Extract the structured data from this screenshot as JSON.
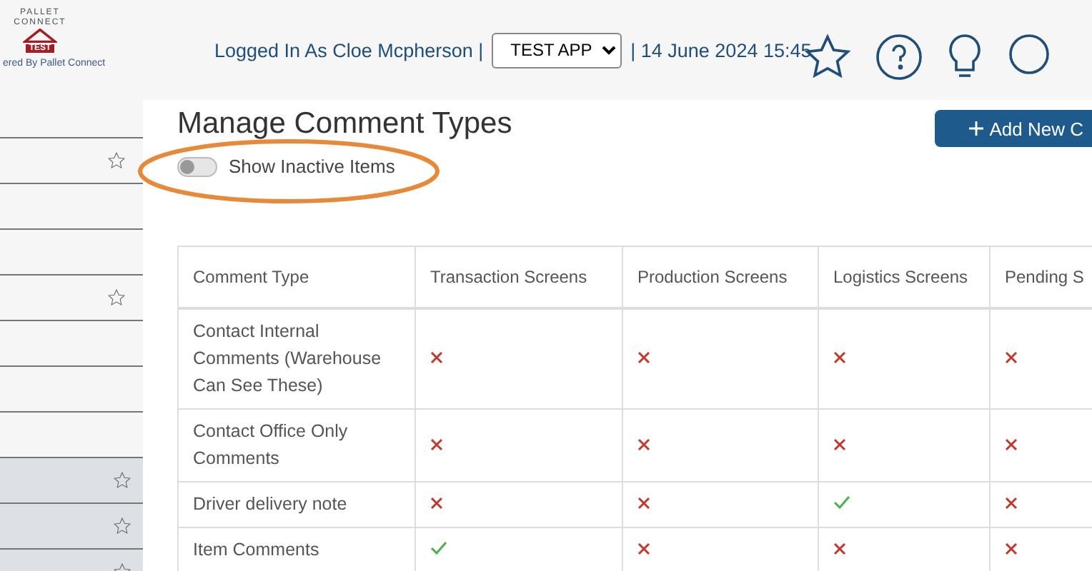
{
  "logo": {
    "wordmark": "PALLET CONNECT",
    "badge": "TEST",
    "tagline": "ered By Pallet Connect"
  },
  "header": {
    "user_text": "Logged In As Cloe Mcpherson |",
    "app_select": {
      "value": "TEST APP"
    },
    "date_text": "| 14 June 2024 15:45"
  },
  "sidebar": {
    "items": [
      {
        "starred": false,
        "highlighted": false
      },
      {
        "starred": true,
        "highlighted": false
      },
      {
        "starred": false,
        "highlighted": false
      },
      {
        "starred": false,
        "highlighted": false
      },
      {
        "starred": true,
        "highlighted": false
      },
      {
        "starred": false,
        "highlighted": false
      },
      {
        "starred": false,
        "highlighted": false
      },
      {
        "starred": false,
        "highlighted": false
      },
      {
        "starred": true,
        "highlighted": true
      },
      {
        "starred": true,
        "highlighted": true
      },
      {
        "starred": true,
        "highlighted": true
      }
    ]
  },
  "page": {
    "title": "Manage Comment Types",
    "add_button": "Add New C",
    "toggle": {
      "label": "Show Inactive Items",
      "on": false
    }
  },
  "table": {
    "columns": [
      "Comment Type",
      "Transaction Screens",
      "Production Screens",
      "Logistics Screens",
      "Pending S"
    ],
    "rows": [
      {
        "name": "Contact Internal Comments (Warehouse Can See These)",
        "cells": [
          {
            "enabled": false
          },
          {
            "enabled": false
          },
          {
            "enabled": false
          },
          {
            "enabled": false
          }
        ]
      },
      {
        "name": "Contact Office Only Comments",
        "cells": [
          {
            "enabled": false
          },
          {
            "enabled": false
          },
          {
            "enabled": false
          },
          {
            "enabled": false
          }
        ]
      },
      {
        "name": "Driver delivery note",
        "cells": [
          {
            "enabled": false
          },
          {
            "enabled": false
          },
          {
            "enabled": true
          },
          {
            "enabled": false
          }
        ]
      },
      {
        "name": "Item Comments",
        "cells": [
          {
            "enabled": true
          },
          {
            "enabled": false
          },
          {
            "enabled": false
          },
          {
            "enabled": false
          }
        ]
      }
    ]
  }
}
